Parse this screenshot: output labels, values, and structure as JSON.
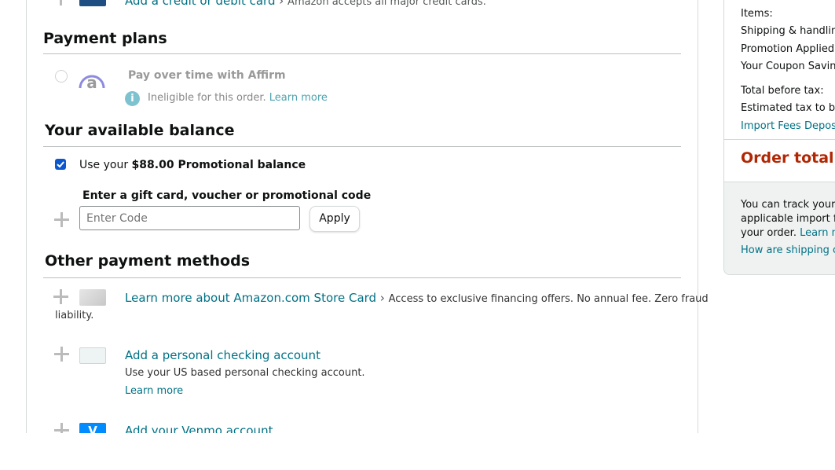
{
  "top_row": {
    "link": "Add a credit or debit card",
    "chevron": "›",
    "note": "Amazon accepts all major credit cards."
  },
  "payment_plans": {
    "heading": "Payment plans",
    "affirm_label": "Pay over time with Affirm",
    "ineligible_text": "Ineligible for this order.",
    "learn_more": "Learn more"
  },
  "balance": {
    "heading": "Your available balance",
    "use_prefix": "Use your",
    "amount_label": "$88.00 Promotional balance",
    "gift_label": "Enter a gift card, voucher or promotional code",
    "code_placeholder": "Enter Code",
    "apply_label": "Apply"
  },
  "other_methods": {
    "heading": "Other payment methods",
    "store_card_link": "Learn more about Amazon.com Store Card",
    "store_card_chevron": "›",
    "store_card_note_1": "Access to exclusive financing offers. No annual fee. Zero fraud",
    "store_card_note_2": "liability.",
    "checking_link": "Add a personal checking account",
    "checking_note": "Use your US based personal checking account.",
    "checking_learn_more": "Learn more",
    "venmo_link": "Add your Venmo account"
  },
  "summary": {
    "items_label": "Items:",
    "shipping_label": "Shipping & handling",
    "promotion_label": "Promotion Applied:",
    "coupon_label": "Your Coupon Saving",
    "total_before_tax_label": "Total before tax:",
    "estimated_tax_label": "Estimated tax to be",
    "import_fees_label": "Import Fees Deposit",
    "order_total_label": "Order total:",
    "track_line_1": "You can track your s",
    "track_line_2": "applicable import fe",
    "track_line_3_prefix": "your order.",
    "track_line_3_link": "Learn m",
    "shipping_link": "How are shipping co"
  },
  "colors": {
    "link": "#007185",
    "order_total": "#b12704",
    "checkbox": "#0b57d0",
    "venmo": "#008cff"
  }
}
